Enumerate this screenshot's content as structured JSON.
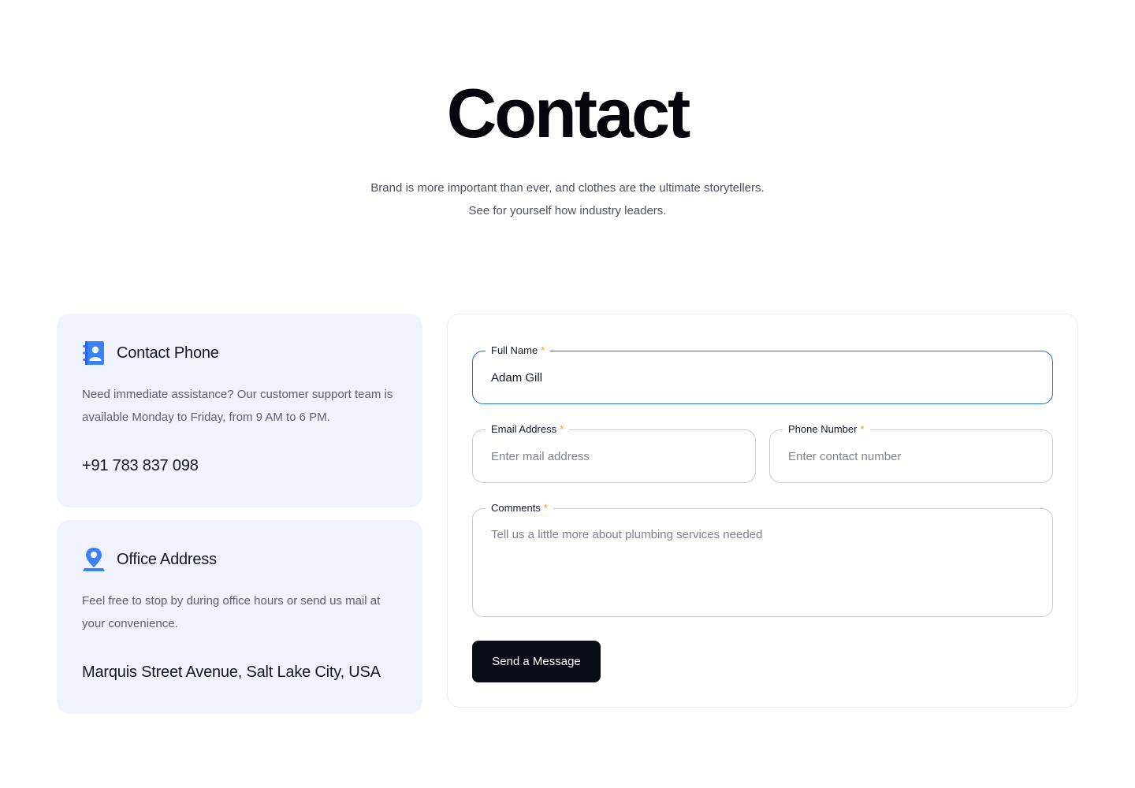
{
  "hero": {
    "title": "Contact",
    "subtitle_line1": "Brand is more important than ever, and clothes are the ultimate storytellers.",
    "subtitle_line2": "See for yourself how industry leaders."
  },
  "contact_phone": {
    "icon": "contact-book-icon",
    "title": "Contact Phone",
    "description": "Need immediate assistance? Our customer support team is available Monday to Friday, from 9 AM to 6 PM.",
    "value": "+91 783 837 098"
  },
  "office_address": {
    "icon": "map-pin-icon",
    "title": "Office Address",
    "description": "Feel free to stop by during office hours or send us mail at your convenience.",
    "value": "Marquis Street Avenue, Salt Lake City, USA"
  },
  "form": {
    "full_name": {
      "label": "Full Name",
      "required_mark": "*",
      "value": "Adam Gill"
    },
    "email": {
      "label": "Email Address",
      "required_mark": "*",
      "placeholder": "Enter mail address"
    },
    "phone": {
      "label": "Phone Number",
      "required_mark": "*",
      "placeholder": "Enter contact number"
    },
    "comments": {
      "label": "Comments",
      "required_mark": "*",
      "placeholder": "Tell us a little more about plumbing services needed"
    },
    "submit_label": "Send a Message"
  },
  "colors": {
    "accent_blue": "#3b82f6",
    "focus_border": "#1f6fd1",
    "required_star": "#f59e0b",
    "card_bg": "#f0f3fb",
    "button_bg": "#080c16"
  }
}
